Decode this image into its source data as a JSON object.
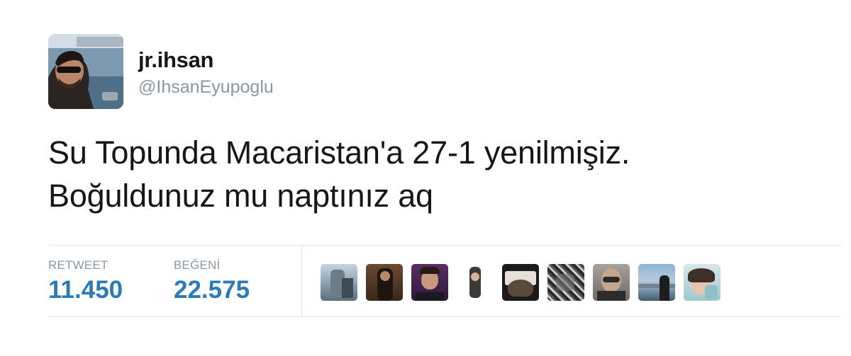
{
  "user": {
    "display_name": "jr.ihsan",
    "handle": "@IhsanEyupoglu"
  },
  "tweet": {
    "lines": [
      "Su Topunda Macaristan'a 27-1 yenilmişiz.",
      "Boğuldunuz mu naptınız aq"
    ]
  },
  "stats": {
    "retweets_label": "RETWEET",
    "retweets_value": "11.450",
    "likes_label": "BEĞENİ",
    "likes_value": "22.575"
  },
  "likers_count_shown": 9,
  "colors": {
    "stat_value": "#2b7bb9",
    "muted": "#8899a6",
    "border": "#e1e8ed"
  }
}
